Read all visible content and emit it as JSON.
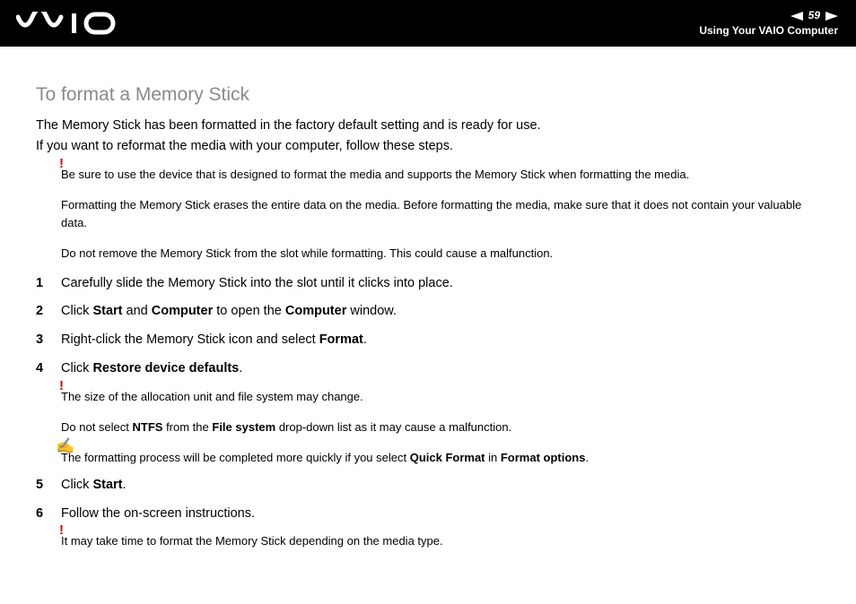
{
  "header": {
    "page_number": "59",
    "section": "Using Your VAIO Computer"
  },
  "title": "To format a Memory Stick",
  "intro": {
    "p1": "The Memory Stick has been formatted in the factory default setting and is ready for use.",
    "p2": "If you want to reformat the media with your computer, follow these steps."
  },
  "warn1": {
    "l1": "Be sure to use the device that is designed to format the media and supports the Memory Stick when formatting the media.",
    "l2": "Formatting the Memory Stick erases the entire data on the media. Before formatting the media, make sure that it does not contain your valuable data.",
    "l3": "Do not remove the Memory Stick from the slot while formatting. This could cause a malfunction."
  },
  "steps": {
    "s1": "Carefully slide the Memory Stick into the slot until it clicks into place.",
    "s2": {
      "pre": "Click ",
      "b1": "Start",
      "mid": " and ",
      "b2": "Computer",
      "mid2": " to open the ",
      "b3": "Computer",
      "post": " window."
    },
    "s3": {
      "pre": "Right-click the Memory Stick icon and select ",
      "b1": "Format",
      "post": "."
    },
    "s4": {
      "pre": "Click ",
      "b1": "Restore device defaults",
      "post": "."
    },
    "s5": {
      "pre": "Click ",
      "b1": "Start",
      "post": "."
    },
    "s6": "Follow the on-screen instructions."
  },
  "warn2": {
    "l1": "The size of the allocation unit and file system may change.",
    "l2": {
      "pre": "Do not select ",
      "b1": "NTFS",
      "mid": " from the ",
      "b2": "File system",
      "post": " drop-down list as it may cause a malfunction."
    }
  },
  "note": {
    "pre": "The formatting process will be completed more quickly if you select ",
    "b1": "Quick Format",
    "mid": " in ",
    "b2": "Format options",
    "post": "."
  },
  "warn3": {
    "l1": "It may take time to format the Memory Stick depending on the media type."
  }
}
